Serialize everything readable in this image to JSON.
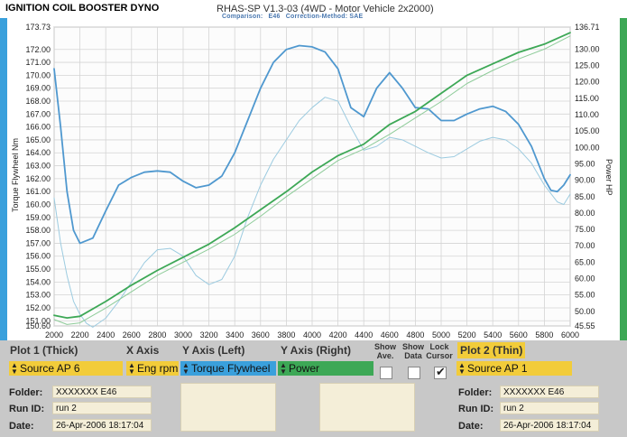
{
  "header": {
    "title": "IGNITION COIL BOOSTER DYNO",
    "app_name": "RHAS-SP V1.3-03",
    "vehicle": "(4WD - Motor Vehicle 2x2000)",
    "comparison_label": "Comparison:",
    "comparison_value": "E46",
    "correction_label": "Correction-Method: SAE"
  },
  "colors": {
    "torque_thick": "#4f98cf",
    "torque_thin": "#9ccbe0",
    "power_thick": "#3da856",
    "power_thin": "#8fcc9a",
    "left_bar": "#3aa0dc",
    "grid": "#d4d4d4"
  },
  "chart_data": {
    "type": "line",
    "xlabel": "",
    "ylabel_left": "Torque Flywheel Nm",
    "ylabel_right": "Power HP",
    "x_ticks": [
      2000,
      2200,
      2400,
      2600,
      2800,
      3000,
      3200,
      3400,
      3600,
      3800,
      4000,
      4200,
      4400,
      4600,
      4800,
      5000,
      5200,
      5400,
      5600,
      5800,
      6000
    ],
    "y_left_ticks": [
      "173.73",
      "172.00",
      "171.00",
      "170.00",
      "169.00",
      "168.00",
      "167.00",
      "166.00",
      "165.00",
      "164.00",
      "163.00",
      "162.00",
      "161.00",
      "160.00",
      "159.00",
      "158.00",
      "157.00",
      "156.00",
      "155.00",
      "154.00",
      "153.00",
      "152.00",
      "151.00",
      "150.60"
    ],
    "y_right_ticks": [
      "136.71",
      "130.00",
      "125.00",
      "120.00",
      "115.00",
      "110.00",
      "105.00",
      "100.00",
      "95.00",
      "90.00",
      "85.00",
      "80.00",
      "75.00",
      "70.00",
      "65.00",
      "60.00",
      "55.00",
      "50.00",
      "45.55"
    ],
    "xlim": [
      2000,
      6000
    ],
    "ylim_left": [
      150.6,
      173.73
    ],
    "ylim_right": [
      45.55,
      136.71
    ],
    "grid": true,
    "series": [
      {
        "axis": "left",
        "style": "thick",
        "x": [
          2000,
          2050,
          2100,
          2150,
          2200,
          2300,
          2400,
          2500,
          2600,
          2700,
          2800,
          2900,
          3000,
          3100,
          3200,
          3300,
          3400,
          3500,
          3600,
          3700,
          3800,
          3900,
          4000,
          4100,
          4200,
          4300,
          4400,
          4500,
          4600,
          4700,
          4800,
          4900,
          5000,
          5100,
          5200,
          5300,
          5400,
          5500,
          5600,
          5700,
          5800,
          5850,
          5900,
          5950,
          6000
        ],
        "y": [
          170.5,
          166,
          161,
          158,
          157,
          157.4,
          159.5,
          161.5,
          162.1,
          162.5,
          162.6,
          162.5,
          161.8,
          161.3,
          161.5,
          162.2,
          164,
          166.5,
          169,
          171,
          172,
          172.3,
          172.2,
          171.8,
          170.5,
          167.5,
          166.8,
          169,
          170.2,
          169,
          167.5,
          167.4,
          166.5,
          166.5,
          167,
          167.4,
          167.6,
          167.2,
          166.2,
          164.5,
          162,
          161.1,
          161,
          161.5,
          162.3
        ]
      },
      {
        "axis": "left",
        "style": "thin",
        "x": [
          2000,
          2050,
          2100,
          2150,
          2200,
          2250,
          2300,
          2400,
          2500,
          2600,
          2700,
          2800,
          2900,
          3000,
          3100,
          3200,
          3300,
          3400,
          3500,
          3600,
          3700,
          3800,
          3900,
          4000,
          4100,
          4200,
          4300,
          4400,
          4500,
          4600,
          4700,
          4800,
          4900,
          5000,
          5100,
          5200,
          5300,
          5400,
          5500,
          5600,
          5700,
          5800,
          5900,
          5950,
          6000
        ],
        "y": [
          160.5,
          157,
          154.5,
          152.5,
          151.5,
          150.8,
          150.5,
          151.2,
          152.5,
          154,
          155.5,
          156.5,
          156.6,
          156,
          154.5,
          153.8,
          154.2,
          156,
          159,
          161.5,
          163.5,
          165,
          166.5,
          167.5,
          168.3,
          168,
          166,
          164.2,
          164.5,
          165.2,
          165,
          164.5,
          164,
          163.6,
          163.7,
          164.3,
          164.9,
          165.2,
          165,
          164.3,
          163.2,
          161.5,
          160.2,
          160,
          160.8
        ]
      },
      {
        "axis": "right",
        "style": "thick",
        "x": [
          2000,
          2100,
          2200,
          2400,
          2600,
          2800,
          3000,
          3200,
          3400,
          3600,
          3800,
          4000,
          4200,
          4400,
          4600,
          4800,
          5000,
          5200,
          5400,
          5600,
          5800,
          6000
        ],
        "y": [
          48.8,
          48,
          48.5,
          53,
          58,
          62.5,
          66.5,
          70.5,
          75.5,
          81,
          86.5,
          92.5,
          97.5,
          101,
          107,
          111,
          116.5,
          122,
          125.5,
          129,
          131.5,
          135
        ]
      },
      {
        "axis": "right",
        "style": "thin",
        "x": [
          2000,
          2100,
          2200,
          2400,
          2600,
          2800,
          3000,
          3200,
          3400,
          3600,
          3800,
          4000,
          4200,
          4400,
          4600,
          4800,
          5000,
          5200,
          5400,
          5600,
          5800,
          6000
        ],
        "y": [
          47.5,
          46,
          46.5,
          51,
          56,
          61,
          65,
          69,
          73.5,
          79,
          85,
          90.5,
          96,
          99.5,
          104,
          109,
          114,
          119.5,
          123.5,
          127,
          130,
          134
        ]
      }
    ]
  },
  "panel": {
    "plot1_label": "Plot 1 (Thick)",
    "xaxis_label": "X Axis",
    "yleft_label": "Y Axis (Left)",
    "yright_label": "Y Axis (Right)",
    "show_ave_label": "Show Ave.",
    "show_data_label": "Show Data",
    "lock_cursor_label": "Lock Cursor",
    "plot2_label": "Plot 2 (Thin)",
    "plot1_source": "Source AP 6",
    "xaxis_value": "Eng rpm",
    "yleft_value": "Torque Flywheel",
    "yright_value": "Power",
    "plot2_source": "Source AP 1",
    "show_ave_checked": false,
    "show_data_checked": false,
    "lock_cursor_checked": true,
    "folder_label": "Folder:",
    "runid_label": "Run ID:",
    "date_label": "Date:",
    "plot1_folder": "XXXXXXX E46",
    "plot1_run": "run 2",
    "plot1_date": "26-Apr-2006  18:17:04",
    "plot2_folder": "XXXXXXX E46",
    "plot2_run": "run 2",
    "plot2_date": "26-Apr-2006  18:17:04",
    "colors": {
      "yellow": "#f2cc3a",
      "blue": "#3aa0dc",
      "green": "#3da856",
      "plot1_label_bg": "#c8c8c8",
      "plot2_label_bg": "#f2cc3a"
    }
  }
}
